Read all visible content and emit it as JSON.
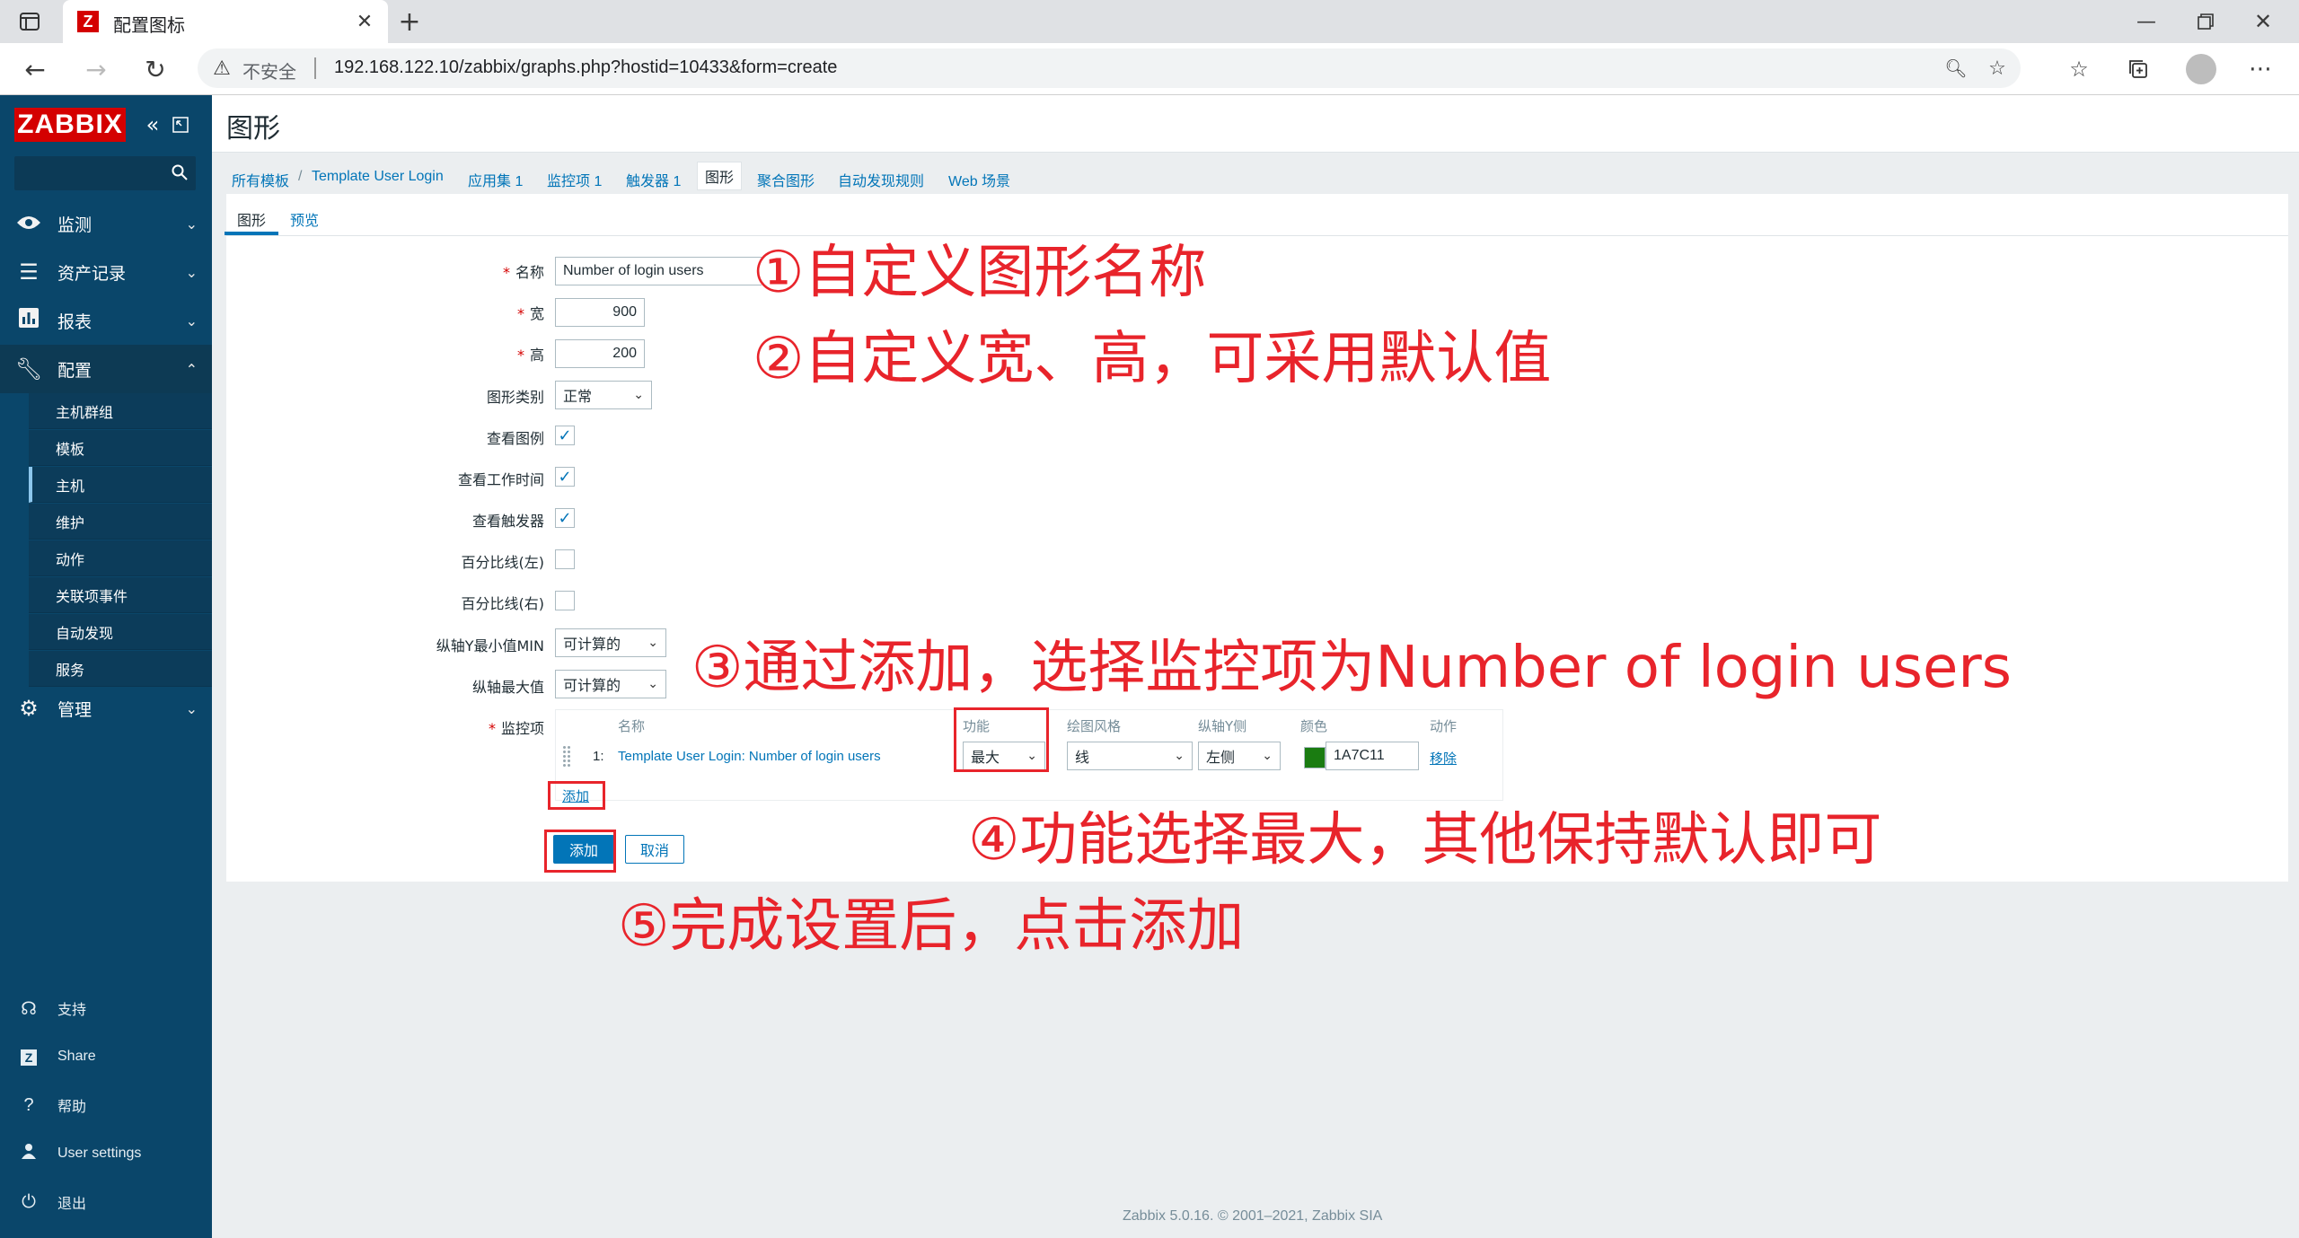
{
  "browser": {
    "tab_title": "配置图标",
    "favicon_letter": "Z",
    "security_label": "不安全",
    "url": "192.168.122.10/zabbix/graphs.php?hostid=10433&form=create"
  },
  "sidebar": {
    "logo": "ZABBIX",
    "menu": [
      {
        "label": "监测",
        "icon": "eye-icon"
      },
      {
        "label": "资产记录",
        "icon": "list-icon"
      },
      {
        "label": "报表",
        "icon": "bar-chart-icon"
      },
      {
        "label": "配置",
        "icon": "wrench-icon"
      },
      {
        "label": "管理",
        "icon": "gear-icon"
      }
    ],
    "submenu": [
      "主机群组",
      "模板",
      "主机",
      "维护",
      "动作",
      "关联项事件",
      "自动发现",
      "服务"
    ],
    "footer": [
      {
        "label": "支持",
        "icon": "headset-icon"
      },
      {
        "label": "Share",
        "icon": "share-z-icon"
      },
      {
        "label": "帮助",
        "icon": "question-icon"
      },
      {
        "label": "User settings",
        "icon": "user-icon"
      },
      {
        "label": "退出",
        "icon": "power-icon"
      }
    ]
  },
  "page": {
    "title": "图形",
    "breadcrumb": {
      "all_templates": "所有模板",
      "separator": "/",
      "template": "Template User Login",
      "apps": "应用集 1",
      "items": "监控项 1",
      "triggers": "触发器 1",
      "graphs": "图形",
      "screens": "聚合图形",
      "discovery": "自动发现规则",
      "web": "Web 场景"
    },
    "subtabs": {
      "graph": "图形",
      "preview": "预览"
    }
  },
  "form": {
    "name_label": "名称",
    "name_value": "Number of login users",
    "width_label": "宽",
    "width_value": "900",
    "height_label": "高",
    "height_value": "200",
    "graph_type_label": "图形类别",
    "graph_type_value": "正常",
    "show_legend_label": "查看图例",
    "show_work_period_label": "查看工作时间",
    "show_triggers_label": "查看触发器",
    "percentile_left_label": "百分比线(左)",
    "percentile_right_label": "百分比线(右)",
    "y_min_label": "纵轴Y最小值MIN",
    "y_min_value": "可计算的",
    "y_max_label": "纵轴最大值",
    "y_max_value": "可计算的",
    "items_label": "监控项",
    "checkbox_checked_glyph": "✓",
    "items_table": {
      "headers": {
        "name": "名称",
        "function": "功能",
        "draw_style": "绘图风格",
        "y_side": "纵轴Y侧",
        "color": "颜色",
        "action": "动作"
      },
      "rows": [
        {
          "index": "1:",
          "name": "Template User Login: Number of login users",
          "function": "最大",
          "draw_style": "线",
          "y_side": "左侧",
          "color": "1A7C11",
          "color_hex": "#1a7c11",
          "action": "移除"
        }
      ]
    },
    "add_item_link": "添加",
    "submit_button": "添加",
    "cancel_button": "取消"
  },
  "annotations": {
    "a1": "①自定义图形名称",
    "a2": "②自定义宽、高，可采用默认值",
    "a3": "③通过添加，选择监控项为Number of login users",
    "a4": "④功能选择最大，其他保持默认即可",
    "a5": "⑤完成设置后，点击添加"
  },
  "footer": "Zabbix 5.0.16. © 2001–2021, Zabbix SIA",
  "colors": {
    "accent": "#0275b8",
    "sidebar": "#0a466a",
    "logo": "#d40000",
    "annotation": "#e8242b"
  }
}
